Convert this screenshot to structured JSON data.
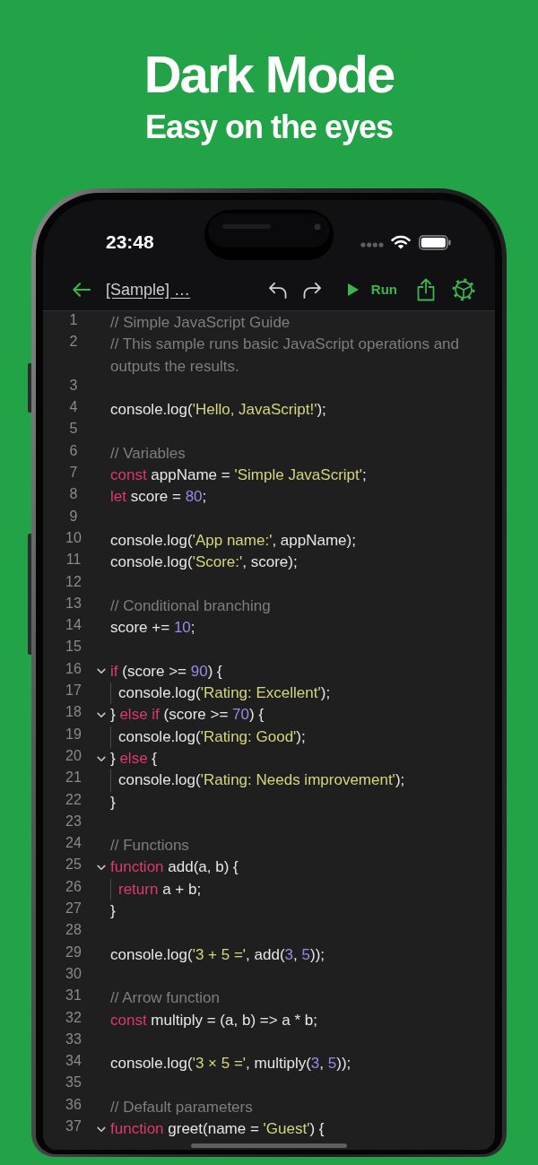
{
  "header": {
    "title": "Dark Mode",
    "subtitle": "Easy on the eyes"
  },
  "status_bar": {
    "time": "23:48"
  },
  "toolbar": {
    "title": "[Sample] …",
    "run_label": "Run"
  },
  "editor": {
    "lines": [
      {
        "number": "1",
        "tokens": [
          {
            "kind": "comment",
            "text": "// Simple JavaScript Guide"
          }
        ]
      },
      {
        "number": "2",
        "tokens": [
          {
            "kind": "comment",
            "text": "// This sample runs basic JavaScript operations and outputs the results."
          }
        ]
      },
      {
        "number": "3"
      },
      {
        "number": "4",
        "tokens": [
          {
            "kind": "plain",
            "text": "console.log("
          },
          {
            "kind": "string",
            "text": "'Hello, JavaScript!'"
          },
          {
            "kind": "plain",
            "text": ");"
          }
        ]
      },
      {
        "number": "5"
      },
      {
        "number": "6",
        "tokens": [
          {
            "kind": "comment",
            "text": "// Variables"
          }
        ]
      },
      {
        "number": "7",
        "tokens": [
          {
            "kind": "keyword",
            "text": "const"
          },
          {
            "kind": "plain",
            "text": " appName = "
          },
          {
            "kind": "string",
            "text": "'Simple JavaScript'"
          },
          {
            "kind": "plain",
            "text": ";"
          }
        ]
      },
      {
        "number": "8",
        "tokens": [
          {
            "kind": "keyword",
            "text": "let"
          },
          {
            "kind": "plain",
            "text": " score = "
          },
          {
            "kind": "number",
            "text": "80"
          },
          {
            "kind": "plain",
            "text": ";"
          }
        ]
      },
      {
        "number": "9"
      },
      {
        "number": "10",
        "tokens": [
          {
            "kind": "plain",
            "text": "console.log("
          },
          {
            "kind": "string",
            "text": "'App name:'"
          },
          {
            "kind": "plain",
            "text": ", appName);"
          }
        ]
      },
      {
        "number": "11",
        "tokens": [
          {
            "kind": "plain",
            "text": "console.log("
          },
          {
            "kind": "string",
            "text": "'Score:'"
          },
          {
            "kind": "plain",
            "text": ", score);"
          }
        ]
      },
      {
        "number": "12"
      },
      {
        "number": "13",
        "tokens": [
          {
            "kind": "comment",
            "text": "// Conditional branching"
          }
        ]
      },
      {
        "number": "14",
        "tokens": [
          {
            "kind": "plain",
            "text": "score += "
          },
          {
            "kind": "number",
            "text": "10"
          },
          {
            "kind": "plain",
            "text": ";"
          }
        ]
      },
      {
        "number": "15"
      },
      {
        "number": "16",
        "expanded": true,
        "tokens": [
          {
            "kind": "keyword",
            "text": "if"
          },
          {
            "kind": "plain",
            "text": " (score >= "
          },
          {
            "kind": "number",
            "text": "90"
          },
          {
            "kind": "plain",
            "text": ") {"
          }
        ],
        "children": [
          {
            "number": "17",
            "tokens": [
              {
                "kind": "plain",
                "text": "console.log("
              },
              {
                "kind": "string",
                "text": "'Rating: Excellent'"
              },
              {
                "kind": "plain",
                "text": ");"
              }
            ]
          }
        ]
      },
      {
        "number": "18",
        "expanded": true,
        "tokens": [
          {
            "kind": "plain",
            "text": "} "
          },
          {
            "kind": "keyword",
            "text": "else if"
          },
          {
            "kind": "plain",
            "text": " (score >= "
          },
          {
            "kind": "number",
            "text": "70"
          },
          {
            "kind": "plain",
            "text": ") {"
          }
        ],
        "children": [
          {
            "number": "19",
            "tokens": [
              {
                "kind": "plain",
                "text": "console.log("
              },
              {
                "kind": "string",
                "text": "'Rating: Good'"
              },
              {
                "kind": "plain",
                "text": ");"
              }
            ]
          }
        ]
      },
      {
        "number": "20",
        "expanded": true,
        "tokens": [
          {
            "kind": "plain",
            "text": "} "
          },
          {
            "kind": "keyword",
            "text": "else"
          },
          {
            "kind": "plain",
            "text": " {"
          }
        ],
        "children": [
          {
            "number": "21",
            "tokens": [
              {
                "kind": "plain",
                "text": "console.log("
              },
              {
                "kind": "string",
                "text": "'Rating: Needs improvement'"
              },
              {
                "kind": "plain",
                "text": ");"
              }
            ]
          }
        ]
      },
      {
        "number": "22",
        "tokens": [
          {
            "kind": "plain",
            "text": "}"
          }
        ]
      },
      {
        "number": "23"
      },
      {
        "number": "24",
        "tokens": [
          {
            "kind": "comment",
            "text": "// Functions"
          }
        ]
      },
      {
        "number": "25",
        "expanded": true,
        "tokens": [
          {
            "kind": "keyword",
            "text": "function"
          },
          {
            "kind": "plain",
            "text": " add(a, b) {"
          }
        ],
        "children": [
          {
            "number": "26",
            "tokens": [
              {
                "kind": "keyword",
                "text": "return"
              },
              {
                "kind": "plain",
                "text": " a + b;"
              }
            ]
          }
        ]
      },
      {
        "number": "27",
        "tokens": [
          {
            "kind": "plain",
            "text": "}"
          }
        ]
      },
      {
        "number": "28"
      },
      {
        "number": "29",
        "tokens": [
          {
            "kind": "plain",
            "text": "console.log("
          },
          {
            "kind": "string",
            "text": "'3 + 5 ='"
          },
          {
            "kind": "plain",
            "text": ", add("
          },
          {
            "kind": "number",
            "text": "3"
          },
          {
            "kind": "plain",
            "text": ", "
          },
          {
            "kind": "number",
            "text": "5"
          },
          {
            "kind": "plain",
            "text": "));"
          }
        ]
      },
      {
        "number": "30"
      },
      {
        "number": "31",
        "tokens": [
          {
            "kind": "comment",
            "text": "// Arrow function"
          }
        ]
      },
      {
        "number": "32",
        "tokens": [
          {
            "kind": "keyword",
            "text": "const"
          },
          {
            "kind": "plain",
            "text": " multiply = (a, b) => a * b;"
          }
        ]
      },
      {
        "number": "33"
      },
      {
        "number": "34",
        "tokens": [
          {
            "kind": "plain",
            "text": "console.log("
          },
          {
            "kind": "string",
            "text": "'3 × 5 ='"
          },
          {
            "kind": "plain",
            "text": ", multiply("
          },
          {
            "kind": "number",
            "text": "3"
          },
          {
            "kind": "plain",
            "text": ", "
          },
          {
            "kind": "number",
            "text": "5"
          },
          {
            "kind": "plain",
            "text": "));"
          }
        ]
      },
      {
        "number": "35"
      },
      {
        "number": "36",
        "tokens": [
          {
            "kind": "comment",
            "text": "// Default parameters"
          }
        ]
      },
      {
        "number": "37",
        "expanded": true,
        "tokens": [
          {
            "kind": "keyword",
            "text": "function"
          },
          {
            "kind": "plain",
            "text": " greet(name = "
          },
          {
            "kind": "string",
            "text": "'Guest'"
          },
          {
            "kind": "plain",
            "text": ") {"
          }
        ]
      }
    ]
  }
}
